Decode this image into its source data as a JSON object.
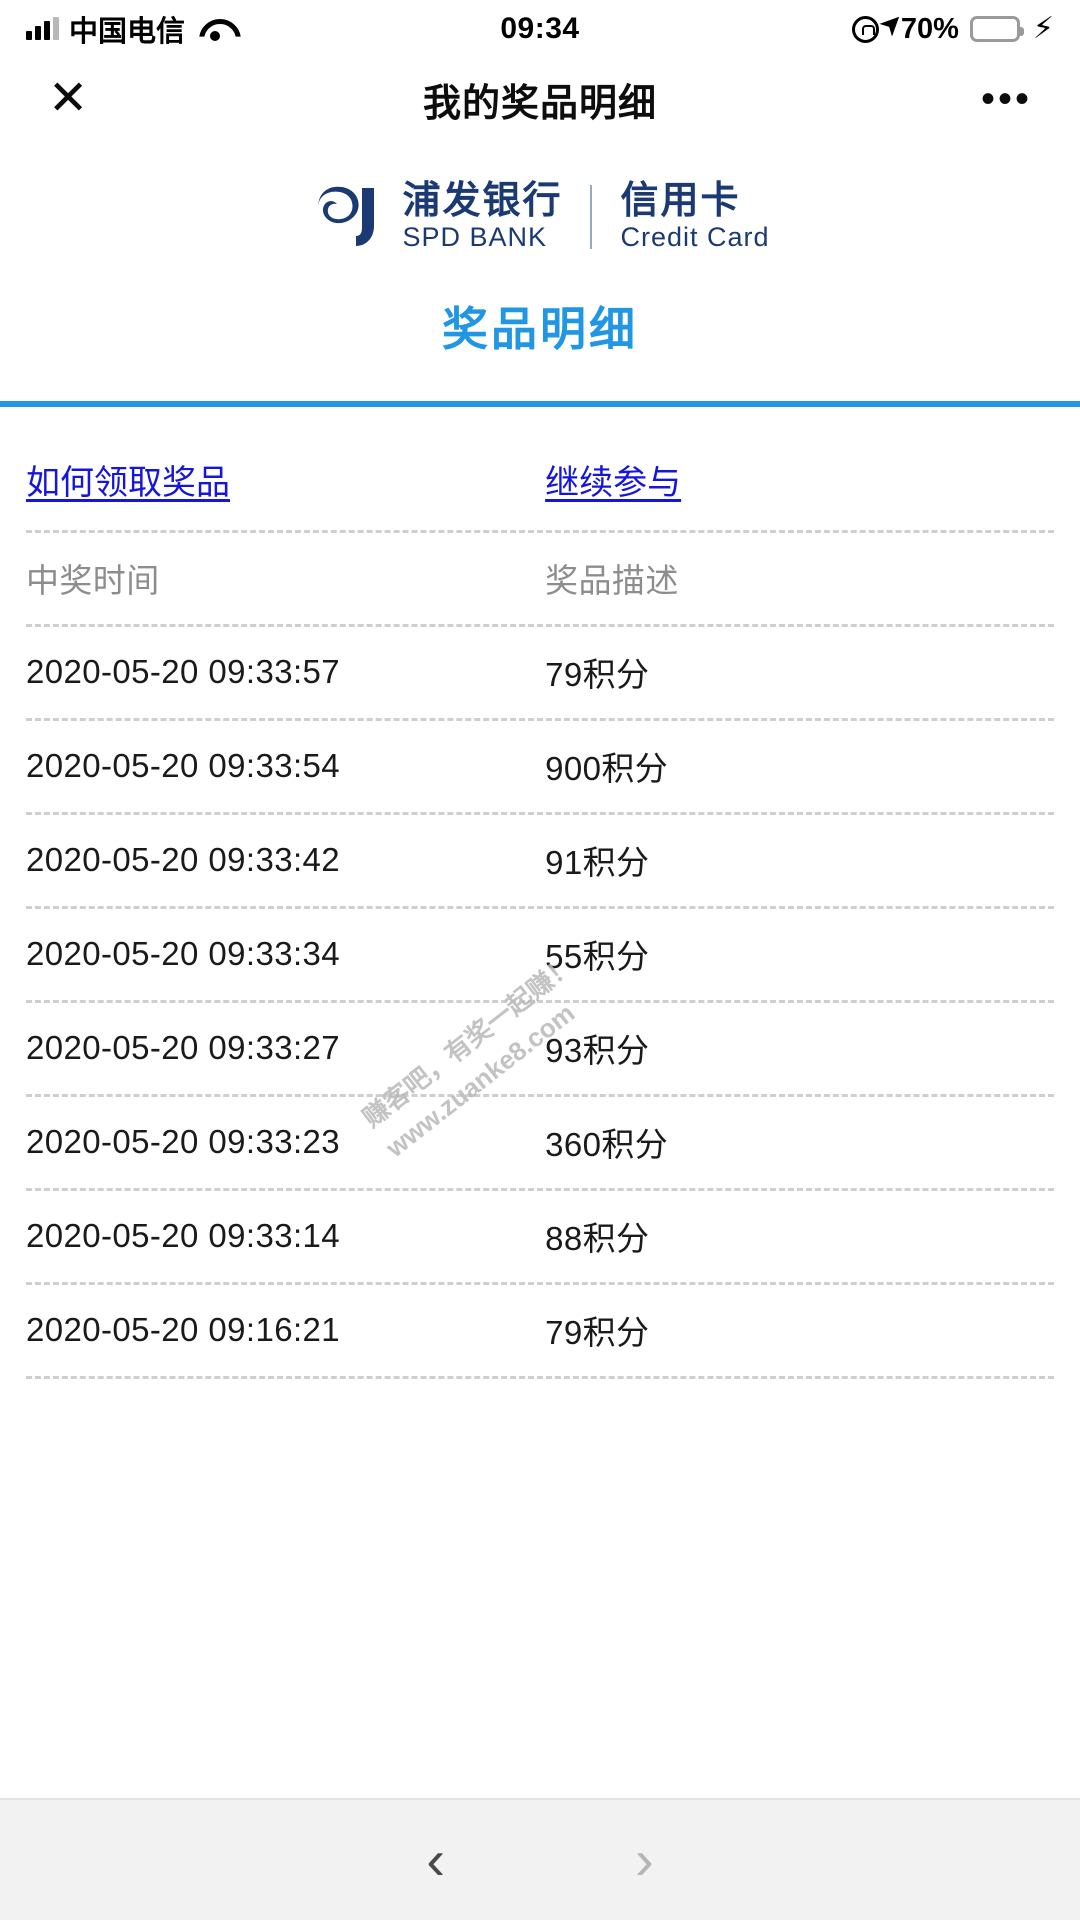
{
  "status_bar": {
    "carrier": "中国电信",
    "time": "09:34",
    "battery_percent": "70%",
    "signal_icon": "signal-bars-icon",
    "wifi_icon": "wifi-icon",
    "rotation_lock_icon": "rotation-lock-icon",
    "location_icon": "location-arrow-icon",
    "battery_icon": "battery-icon",
    "charging_icon": "lightning-bolt-icon",
    "battery_fill_color": "#4cd764"
  },
  "nav_bar": {
    "close_icon": "close-icon",
    "title": "我的奖品明细",
    "more_icon": "more-options-icon",
    "more_label": "•••"
  },
  "brand": {
    "logo_icon": "spd-bank-logo-icon",
    "name_cn": "浦发银行",
    "name_en": "SPD BANK",
    "product_cn": "信用卡",
    "product_en": "Credit Card",
    "color": "#1b3a73"
  },
  "page": {
    "heading": "奖品明细",
    "heading_color": "#2196e3",
    "rule_color": "#2196e3"
  },
  "links": {
    "how_to_claim": "如何领取奖品",
    "continue": "继续参与",
    "color": "#1616d8"
  },
  "table": {
    "columns": [
      "中奖时间",
      "奖品描述"
    ],
    "rows": [
      {
        "time": "2020-05-20 09:33:57",
        "desc": "79积分"
      },
      {
        "time": "2020-05-20 09:33:54",
        "desc": "900积分"
      },
      {
        "time": "2020-05-20 09:33:42",
        "desc": "91积分"
      },
      {
        "time": "2020-05-20 09:33:34",
        "desc": "55积分"
      },
      {
        "time": "2020-05-20 09:33:27",
        "desc": "93积分"
      },
      {
        "time": "2020-05-20 09:33:23",
        "desc": "360积分"
      },
      {
        "time": "2020-05-20 09:33:14",
        "desc": "88积分"
      },
      {
        "time": "2020-05-20 09:16:21",
        "desc": "79积分"
      }
    ]
  },
  "watermark": {
    "line1": "赚客吧，有奖一起赚！",
    "line2": "www.zuanke8.com"
  },
  "bottom_bar": {
    "back_icon": "chevron-left-icon",
    "back_label": "‹",
    "forward_icon": "chevron-right-icon",
    "forward_label": "›"
  }
}
